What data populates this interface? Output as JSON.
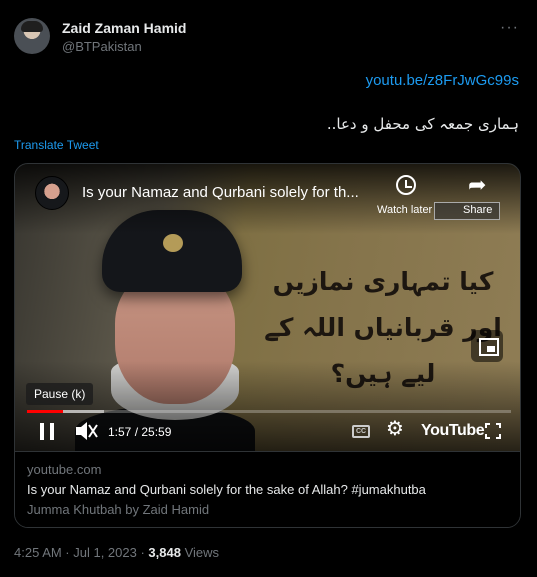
{
  "author": {
    "name": "Zaid Zaman Hamid",
    "handle": "@BTPakistan"
  },
  "more_glyph": "···",
  "tweet": {
    "link": "youtu.be/z8FrJwGc99s",
    "text": "ہماری جمعہ کی محفل و دعا..",
    "translate_label": "Translate Tweet"
  },
  "video": {
    "title": "Is your Namaz and Qurbani solely for th...",
    "watch_later_label": "Watch later",
    "share_label": "Share",
    "overlay_text": "کیا تمہاری نمازیں اور قربانیاں اللہ کے لیے ہیں؟",
    "pause_tooltip": "Pause (k)",
    "time": "1:57 / 25:59",
    "progress": 0.075,
    "buffered": 0.16,
    "logo_text": "YouTube",
    "icons": [
      "clock-icon",
      "share-icon",
      "pip-icon",
      "pause-icon",
      "mute-icon",
      "cc-icon",
      "gear-icon",
      "fullscreen-icon"
    ]
  },
  "card": {
    "domain": "youtube.com",
    "title": "Is your Namaz and Qurbani solely for the sake of Allah? #jumakhutba",
    "description": "Jumma Khutbah by Zaid Hamid"
  },
  "footer": {
    "timestamp": "4:25 AM · Jul 1, 2023 · ",
    "views_count": "3,848",
    "views_label": " Views"
  },
  "colors": {
    "background": "#000000",
    "link": "#1d9bf0",
    "secondary_text": "#71767b",
    "progress": "#ff0000"
  }
}
